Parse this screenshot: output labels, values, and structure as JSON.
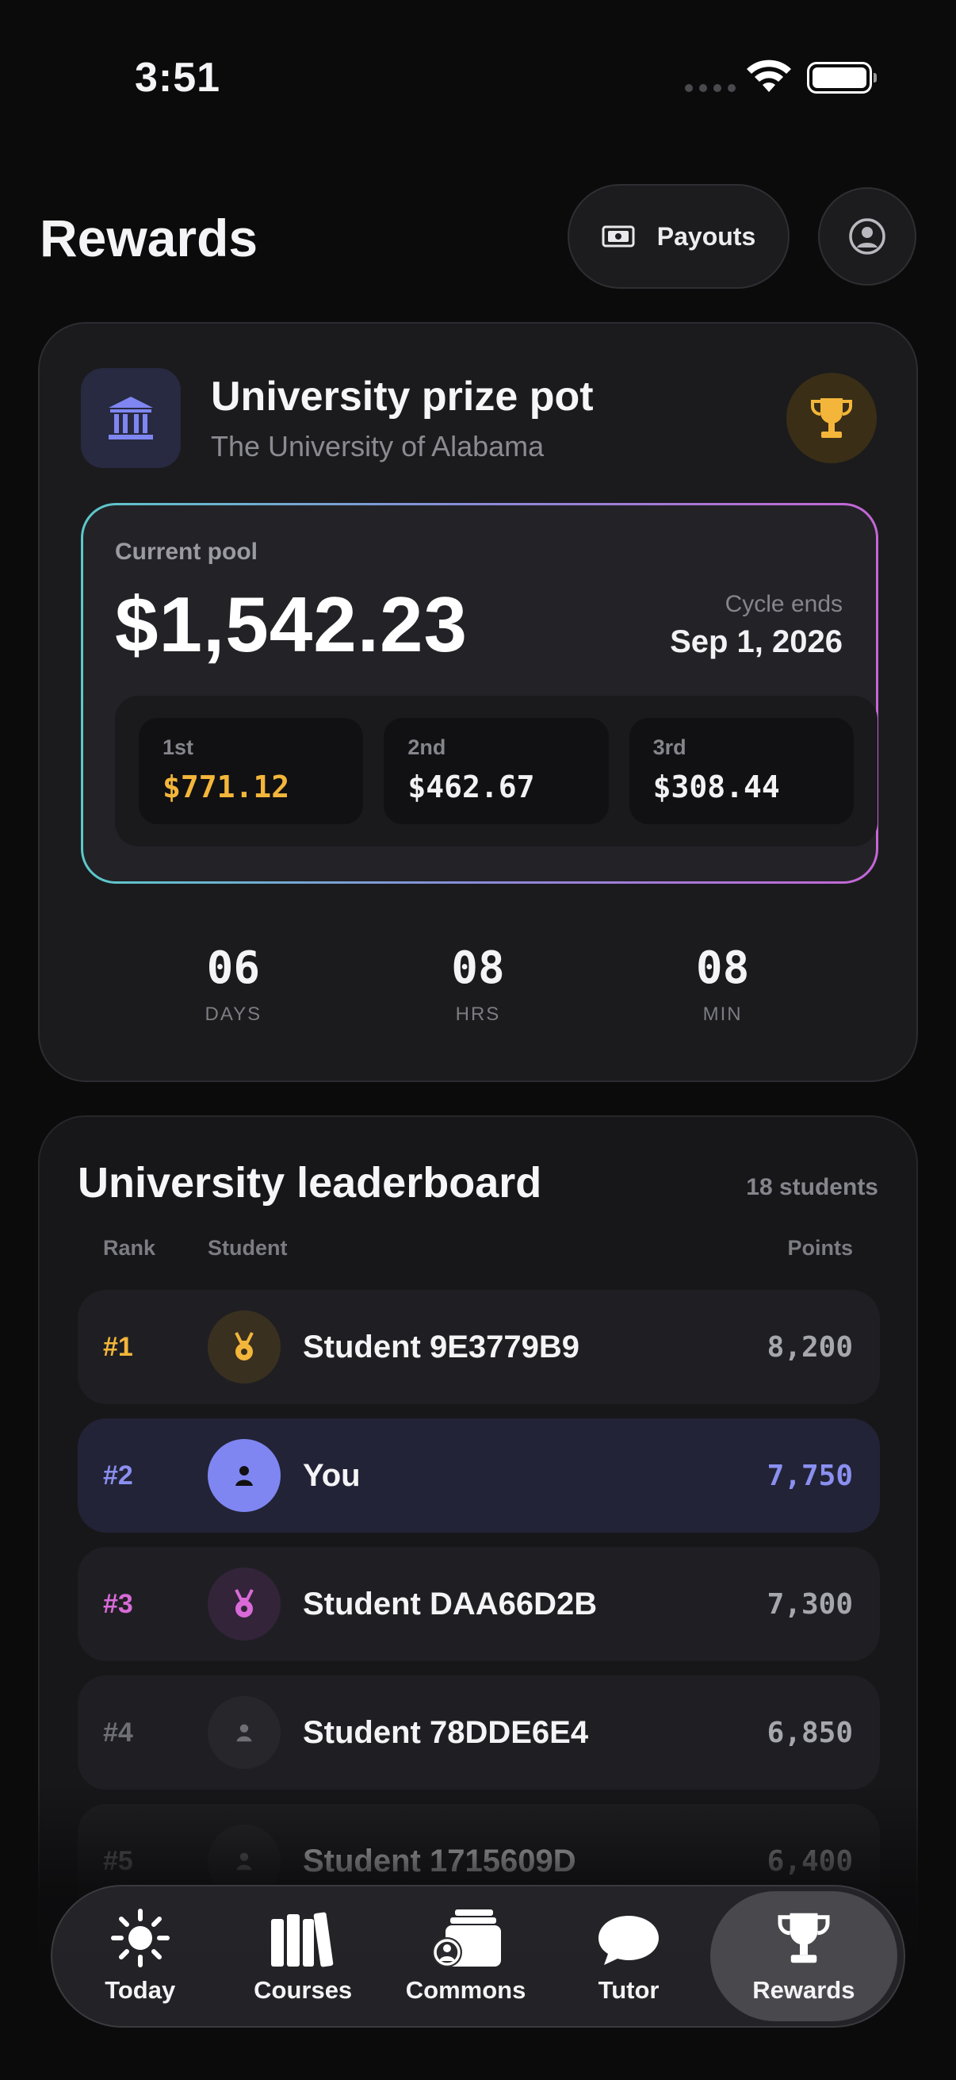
{
  "status_bar": {
    "time": "3:51"
  },
  "header": {
    "title": "Rewards",
    "payouts_label": "Payouts"
  },
  "prize": {
    "title": "University prize pot",
    "university": "The University of Alabama",
    "pool_label": "Current pool",
    "pool_amount": "$1,542.23",
    "cycle_label": "Cycle ends",
    "cycle_date": "Sep 1, 2026",
    "splits": [
      {
        "place": "1st",
        "amount": "$771.12"
      },
      {
        "place": "2nd",
        "amount": "$462.67"
      },
      {
        "place": "3rd",
        "amount": "$308.44"
      }
    ],
    "countdown": [
      {
        "value": "06",
        "unit": "DAYS"
      },
      {
        "value": "08",
        "unit": "HRS"
      },
      {
        "value": "08",
        "unit": "MIN"
      }
    ]
  },
  "leaderboard": {
    "title": "University leaderboard",
    "count": "18 students",
    "headers": {
      "rank": "Rank",
      "student": "Student",
      "points": "Points"
    },
    "rows": [
      {
        "rank": "#1",
        "name": "Student 9E3779B9",
        "points": "8,200"
      },
      {
        "rank": "#2",
        "name": "You",
        "points": "7,750"
      },
      {
        "rank": "#3",
        "name": "Student DAA66D2B",
        "points": "7,300"
      },
      {
        "rank": "#4",
        "name": "Student 78DDE6E4",
        "points": "6,850"
      },
      {
        "rank": "#5",
        "name": "Student 1715609D",
        "points": "6,400"
      }
    ]
  },
  "tabs": [
    {
      "label": "Today",
      "icon": "sun-icon"
    },
    {
      "label": "Courses",
      "icon": "books-icon"
    },
    {
      "label": "Commons",
      "icon": "commons-icon"
    },
    {
      "label": "Tutor",
      "icon": "chat-bubble-icon"
    },
    {
      "label": "Rewards",
      "icon": "trophy-icon",
      "active": true
    }
  ],
  "colors": {
    "gold": "#f4b63a",
    "you_accent": "#8a8ff0",
    "third_accent": "#d96ad8",
    "muted": "#6f6f76"
  }
}
